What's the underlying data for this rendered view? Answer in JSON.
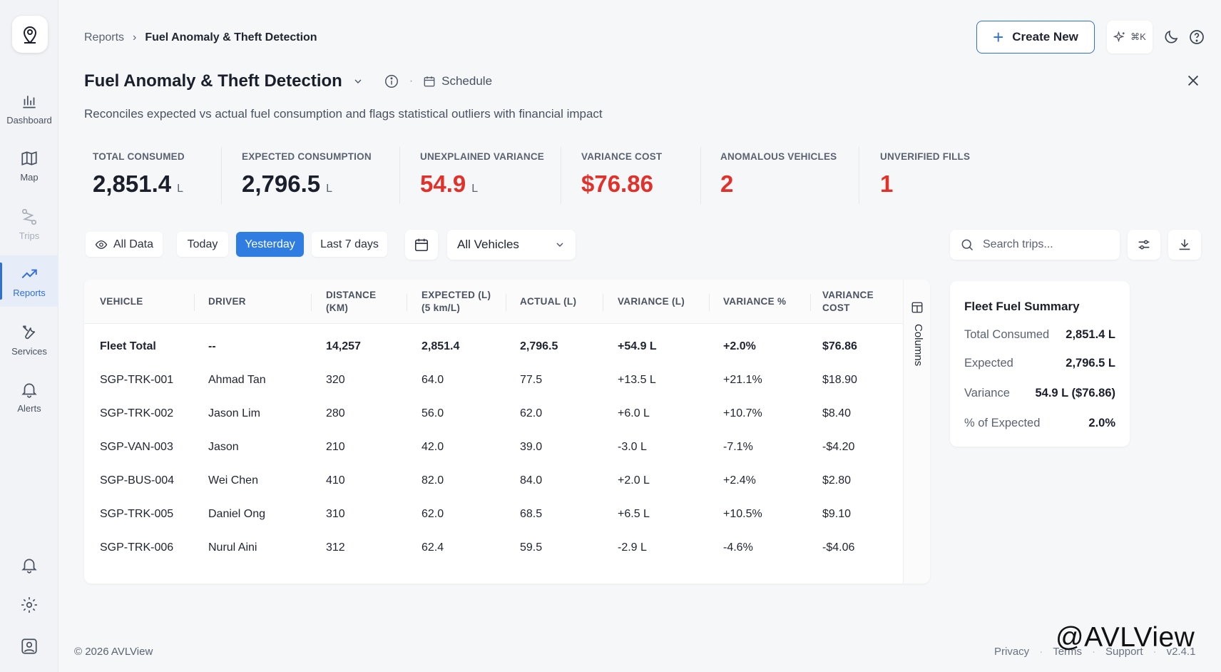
{
  "sidebar": {
    "items": [
      {
        "label": "Dashboard",
        "icon": "bar-chart-icon"
      },
      {
        "label": "Map",
        "icon": "map-icon"
      },
      {
        "label": "Trips",
        "icon": "route-icon"
      },
      {
        "label": "Reports",
        "icon": "trending-up-icon"
      },
      {
        "label": "Services",
        "icon": "tools-icon"
      },
      {
        "label": "Alerts",
        "icon": "bell-icon"
      }
    ],
    "bottom_icons": [
      "bell-icon",
      "gear-icon",
      "user-icon"
    ]
  },
  "breadcrumb": {
    "parent": "Reports",
    "separator": "›",
    "current": "Fuel Anomaly & Theft Detection"
  },
  "header": {
    "create_label": "Create New",
    "shortcut": "⌘K"
  },
  "page": {
    "title": "Fuel Anomaly & Theft Detection",
    "schedule_label": "Schedule",
    "subtitle": "Reconciles expected vs actual fuel consumption and flags statistical outliers with financial impact"
  },
  "kpis": [
    {
      "label": "TOTAL CONSUMED",
      "value": "2,851.4",
      "unit": "L"
    },
    {
      "label": "EXPECTED CONSUMPTION",
      "value": "2,796.5",
      "unit": "L"
    },
    {
      "label": "UNEXPLAINED VARIANCE",
      "value": "54.9",
      "unit": "L"
    },
    {
      "label": "VARIANCE COST",
      "value": "$76.86",
      "unit": ""
    },
    {
      "label": "ANOMALOUS VEHICLES",
      "value": "2",
      "unit": ""
    },
    {
      "label": "UNVERIFIED FILLS",
      "value": "1",
      "unit": ""
    }
  ],
  "filters": {
    "all_data": "All Data",
    "today": "Today",
    "yesterday": "Yesterday",
    "last7": "Last 7 days",
    "vehicle_select": "All Vehicles",
    "search_placeholder": "Search trips..."
  },
  "table": {
    "headers": [
      "VEHICLE",
      "DRIVER",
      "DISTANCE (KM)",
      "EXPECTED (L) (5 km/L)",
      "ACTUAL (L)",
      "VARIANCE (L)",
      "VARIANCE %",
      "VARIANCE COST"
    ],
    "header_lines": [
      [
        "VEHICLE"
      ],
      [
        "DRIVER"
      ],
      [
        "DISTANCE",
        "(KM)"
      ],
      [
        "EXPECTED (L)",
        "(5 km/L)"
      ],
      [
        "ACTUAL (L)"
      ],
      [
        "VARIANCE (L)"
      ],
      [
        "VARIANCE %"
      ],
      [
        "VARIANCE",
        "COST"
      ]
    ],
    "rows": [
      [
        "Fleet Total",
        "--",
        "14,257",
        "2,851.4",
        "2,796.5",
        "+54.9 L",
        "+2.0%",
        "$76.86"
      ],
      [
        "SGP-TRK-001",
        "Ahmad Tan",
        "320",
        "64.0",
        "77.5",
        "+13.5 L",
        "+21.1%",
        "$18.90"
      ],
      [
        "SGP-TRK-002",
        "Jason Lim",
        "280",
        "56.0",
        "62.0",
        "+6.0 L",
        "+10.7%",
        "$8.40"
      ],
      [
        "SGP-VAN-003",
        "Jason",
        "210",
        "42.0",
        "39.0",
        "-3.0 L",
        "-7.1%",
        "-$4.20"
      ],
      [
        "SGP-BUS-004",
        "Wei Chen",
        "410",
        "82.0",
        "84.0",
        "+2.0 L",
        "+2.4%",
        "$2.80"
      ],
      [
        "SGP-TRK-005",
        "Daniel Ong",
        "310",
        "62.0",
        "68.5",
        "+6.5 L",
        "+10.5%",
        "$9.10"
      ],
      [
        "SGP-TRK-006",
        "Nurul Aini",
        "312",
        "62.4",
        "59.5",
        "-2.9 L",
        "-4.6%",
        "-$4.06"
      ]
    ],
    "columns_label": "Columns"
  },
  "summary": {
    "title": "Fleet Fuel Summary",
    "rows": [
      {
        "k": "Total Consumed",
        "v": "2,851.4 L"
      },
      {
        "k": "Expected",
        "v": "2,796.5 L"
      },
      {
        "k": "Variance",
        "v": "54.9 L ($76.86)"
      },
      {
        "k": "% of Expected",
        "v": "2.0%"
      }
    ]
  },
  "footer": {
    "copyright": "© 2026 AVLView",
    "links": [
      "Privacy",
      "Terms",
      "Support",
      "v2.4.1"
    ]
  },
  "watermark": "@AVLView",
  "colors": {
    "accent": "#2f6fd6",
    "danger": "#e0312b"
  }
}
